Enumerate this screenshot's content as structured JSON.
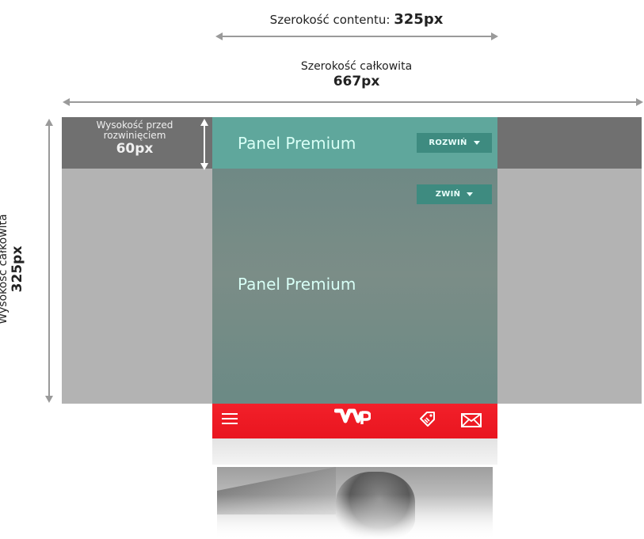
{
  "annotations": {
    "content_width_label": "Szerokość contentu:",
    "content_width_value": "325px",
    "total_width_label": "Szerokość całkowita",
    "total_width_value": "667px",
    "total_height_label": "Wysokość całkowita",
    "total_height_value": "325px",
    "collapsed_height_line1": "Wysokość przed",
    "collapsed_height_line2": "rozwinięciem",
    "collapsed_height_value": "60px"
  },
  "panel": {
    "title_collapsed": "Panel Premium",
    "title_expanded": "Panel Premium",
    "expand_label": "ROZWIŃ",
    "collapse_label": "ZWIŃ"
  },
  "colors": {
    "collapsed_panel": "#5fa79c",
    "expanded_panel": "#768c86",
    "button": "#3e8b80",
    "wp_red": "#ee1c25",
    "side_gray": "#b3b3b3",
    "dark_band": "#707070"
  },
  "wp_header": {
    "logo_text": "WP",
    "icons": [
      "hamburger-menu-icon",
      "tag-icon",
      "mail-icon"
    ]
  }
}
